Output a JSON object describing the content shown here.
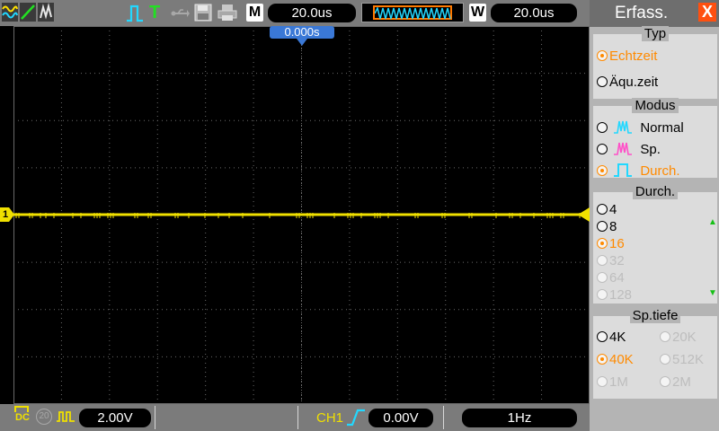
{
  "top_bar": {
    "mode_label": "M",
    "timebase": "20.0us",
    "window_label": "W",
    "window_timebase": "20.0us",
    "trigger_status": "T",
    "trigger_position": "0.000s"
  },
  "bottom_bar": {
    "coupling": "DC",
    "bw_limit": "20",
    "ch1_scale": "2.00V",
    "trigger_source": "CH1",
    "trigger_level": "0.00V",
    "frequency": "1Hz"
  },
  "channel_marker": "1",
  "menu": {
    "title": "Erfass.",
    "close": "X",
    "groups": {
      "typ": {
        "title": "Typ",
        "options": [
          {
            "label": "Echtzeit",
            "state": "selected"
          },
          {
            "label": "Äqu.zeit",
            "state": "normal"
          }
        ]
      },
      "modus": {
        "title": "Modus",
        "options": [
          {
            "label": "Normal",
            "state": "normal"
          },
          {
            "label": "Sp.",
            "state": "normal"
          },
          {
            "label": "Durch.",
            "state": "selected"
          }
        ]
      },
      "durch": {
        "title": "Durch.",
        "options": [
          {
            "label": "4",
            "state": "normal"
          },
          {
            "label": "8",
            "state": "normal"
          },
          {
            "label": "16",
            "state": "selected"
          },
          {
            "label": "32",
            "state": "disabled"
          },
          {
            "label": "64",
            "state": "disabled"
          },
          {
            "label": "128",
            "state": "disabled"
          }
        ]
      },
      "sptiefe": {
        "title": "Sp.tiefe",
        "options": [
          {
            "label": "4K",
            "state": "normal"
          },
          {
            "label": "20K",
            "state": "disabled"
          },
          {
            "label": "40K",
            "state": "selected"
          },
          {
            "label": "512K",
            "state": "disabled"
          },
          {
            "label": "1M",
            "state": "disabled"
          },
          {
            "label": "2M",
            "state": "disabled"
          }
        ]
      }
    }
  },
  "colors": {
    "trace": "#f0e000",
    "accent": "#ff8a00",
    "cyan": "#22d8ff",
    "green": "#16c016"
  }
}
